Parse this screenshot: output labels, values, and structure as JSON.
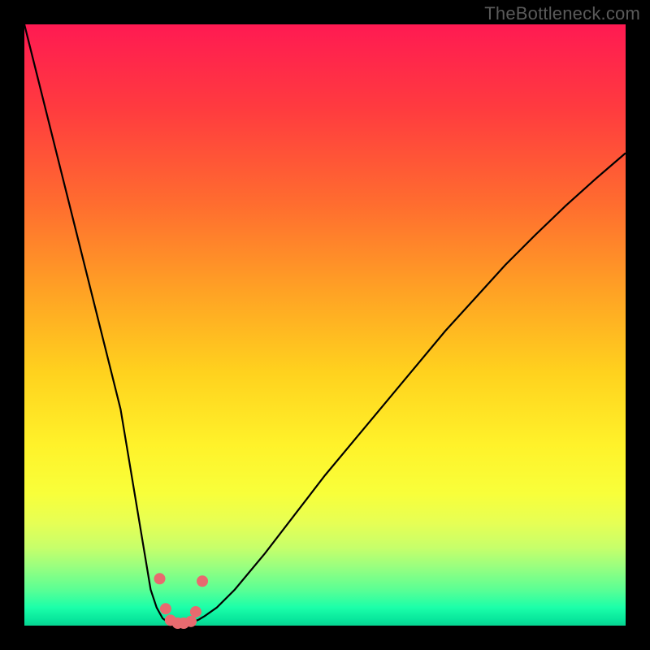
{
  "watermark": "TheBottleneck.com",
  "colors": {
    "frame": "#000000",
    "gradient_top": "#ff1a52",
    "gradient_bottom": "#07d492",
    "curve": "#000000",
    "marker": "#e86a6f"
  },
  "chart_data": {
    "type": "line",
    "title": "",
    "xlabel": "",
    "ylabel": "",
    "xlim": [
      0,
      100
    ],
    "ylim": [
      0,
      100
    ],
    "grid": false,
    "series": [
      {
        "name": "bottleneck-curve",
        "x": [
          0,
          2,
          4,
          6,
          8,
          10,
          12,
          14,
          16,
          17,
          18,
          19,
          20,
          21,
          22,
          23,
          24,
          25,
          26,
          27,
          28,
          29,
          30,
          32,
          35,
          40,
          45,
          50,
          55,
          60,
          65,
          70,
          75,
          80,
          85,
          90,
          95,
          100
        ],
        "values": [
          100,
          92,
          84,
          76,
          68,
          60,
          52,
          44,
          36,
          30,
          24,
          18,
          12,
          6,
          3,
          1.2,
          0.5,
          0.3,
          0.3,
          0.4,
          0.6,
          1.0,
          1.6,
          3.0,
          6.0,
          12.0,
          18.5,
          25.0,
          31.0,
          37.0,
          43.0,
          49.0,
          54.5,
          60.0,
          65.0,
          69.8,
          74.3,
          78.6
        ]
      }
    ],
    "markers": {
      "name": "trough-markers",
      "x": [
        22.5,
        23.5,
        24.3,
        25.5,
        26.5,
        27.7,
        28.5,
        29.6
      ],
      "values": [
        7.8,
        2.8,
        0.9,
        0.4,
        0.4,
        0.7,
        2.3,
        7.4
      ]
    },
    "legend": false
  }
}
